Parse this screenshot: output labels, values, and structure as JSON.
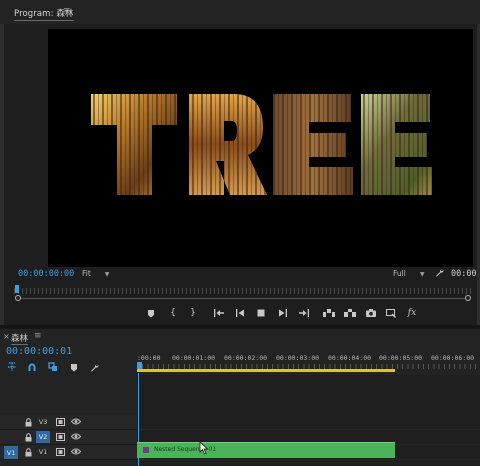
{
  "program_monitor": {
    "title": "Program: 森林",
    "menu_glyph": "≡",
    "frame_text": "TREE",
    "current_time": "00:00:00:00",
    "zoom_level": "Fit",
    "resolution": "Full",
    "duration": "00:00"
  },
  "transport_controls": [
    {
      "name": "add-marker-button",
      "icon": "marker-icon"
    },
    {
      "name": "mark-in-button",
      "icon": "mark-in-icon",
      "label": "{"
    },
    {
      "name": "mark-out-button",
      "icon": "mark-out-icon",
      "label": "}"
    },
    {
      "name": "go-to-in-button",
      "icon": "go-to-in-icon"
    },
    {
      "name": "step-back-button",
      "icon": "step-back-icon"
    },
    {
      "name": "stop-button",
      "icon": "stop-icon"
    },
    {
      "name": "step-forward-button",
      "icon": "step-forward-icon"
    },
    {
      "name": "go-to-out-button",
      "icon": "go-to-out-icon"
    },
    {
      "name": "lift-button",
      "icon": "lift-icon"
    },
    {
      "name": "extract-button",
      "icon": "extract-icon"
    },
    {
      "name": "export-frame-button",
      "icon": "camera-icon"
    },
    {
      "name": "button-editor-button",
      "icon": "button-editor-icon"
    },
    {
      "name": "effects-button",
      "icon": "fx-icon",
      "label": "fx"
    }
  ],
  "timeline": {
    "close_glyph": "×",
    "title": "森林",
    "menu_glyph": "≡",
    "current_time": "00:00:00:01",
    "ruler_labels": [
      ":00:00",
      "00:00:01:00",
      "00:00:02:00",
      "00:00:03:00",
      "00:00:04:00",
      "00:00:05:00",
      "00:00:06:00"
    ],
    "tracks": [
      {
        "label": "V3",
        "targeted": false,
        "source_patch": ""
      },
      {
        "label": "V2",
        "targeted": true,
        "source_patch": ""
      },
      {
        "label": "V1",
        "targeted": true,
        "source_patch": "V1"
      }
    ],
    "clip": {
      "name": "Nested Sequence 01",
      "track": "V1",
      "start": "00:00:00:00",
      "end": "00:00:05:00"
    }
  },
  "colors": {
    "accent_blue": "#3d9ee5",
    "clip_green": "#4bb35a",
    "work_area_yellow": "#d8c33a",
    "panel_bg": "#232323"
  }
}
